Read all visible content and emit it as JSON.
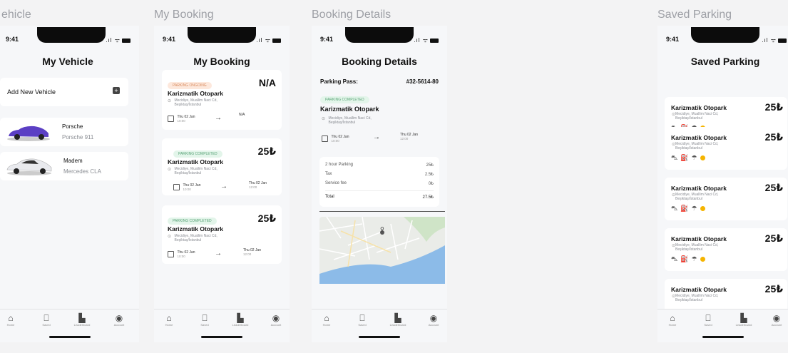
{
  "frames": [
    {
      "title": "ehicle"
    },
    {
      "title": "My Booking"
    },
    {
      "title": "Booking Details"
    },
    {
      "title": "Saved Parking"
    }
  ],
  "status_time": "9:41",
  "vehicle": {
    "title": "My Vehicle",
    "add_label": "Add New Vehicle",
    "cars": [
      {
        "name": "Porsche",
        "model": "Porsche 911",
        "color": "#5b3fc4"
      },
      {
        "name": "Madem",
        "model": "Mercedes CLA",
        "color": "#e9eaee"
      }
    ]
  },
  "booking": {
    "title": "My Booking",
    "cards": [
      {
        "status": "PARKING ONGOING",
        "state": "on",
        "price": "N/A",
        "name": "Karizmatik Otopark",
        "addr1": "Mecidiye, Muallim Naci Cd,",
        "addr2": "Beşiktaş/İstanbul",
        "from_date": "Thu 02 Jan",
        "from_time": "10:00",
        "to_date": "N/A",
        "to_time": ""
      },
      {
        "status": "PARKING COMPLETED",
        "state": "done",
        "price": "25₺",
        "name": "Karizmatik Otopark",
        "addr1": "Mecidiye, Muallim Naci Cd,",
        "addr2": "Beşiktaş/İstanbul",
        "from_date": "Thu 02 Jan",
        "from_time": "10:00",
        "to_date": "Thu 02 Jan",
        "to_time": "12:00"
      },
      {
        "status": "PARKING COMPLETED",
        "state": "done",
        "price": "25₺",
        "name": "Karizmatik Otopark",
        "addr1": "Mecidiye, Muallim Naci Cd,",
        "addr2": "Beşiktaş/İstanbul",
        "from_date": "Thu 02 Jan",
        "from_time": "10:00",
        "to_date": "Thu 02 Jan",
        "to_time": "12:00"
      }
    ]
  },
  "details": {
    "title": "Booking Details",
    "pass_label": "Parking Pass:",
    "pass_value": "#32-5614-80",
    "status": "PARKING COMPLETED",
    "name": "Karizmatik Otopark",
    "addr1": "Mecidiye, Muallim Naci Cd,",
    "addr2": "Beşiktaş/İstanbul",
    "from_date": "Thu 02 Jan",
    "from_time": "10:00",
    "to_date": "Thu 02 Jan",
    "to_time": "12:00",
    "lines": [
      {
        "label": "2 hour Parking",
        "value": "25₺"
      },
      {
        "label": "Tax",
        "value": "2.5₺"
      },
      {
        "label": "Service fee",
        "value": "0₺"
      }
    ],
    "total_label": "Total",
    "total_value": "27.5₺"
  },
  "saved": {
    "title": "Saved Parking",
    "cards": [
      {
        "name": "Karizmatik Otopark",
        "addr1": "Mecidiye, Muallim Naci Cd,",
        "addr2": "Beşiktaş/İstanbul",
        "price": "25₺"
      },
      {
        "name": "Karizmatik Otopark",
        "addr1": "Mecidiye, Muallim Naci Cd,",
        "addr2": "Beşiktaş/İstanbul",
        "price": "25₺"
      },
      {
        "name": "Karizmatik Otopark",
        "addr1": "Mecidiye, Muallim Naci Cd,",
        "addr2": "Beşiktaş/İstanbul",
        "price": "25₺"
      },
      {
        "name": "Karizmatik Otopark",
        "addr1": "Mecidiye, Muallim Naci Cd,",
        "addr2": "Beşiktaş/İstanbul",
        "price": "25₺"
      },
      {
        "name": "Karizmatik Otopark",
        "addr1": "Mecidiye, Muallim Naci Cd,",
        "addr2": "Beşiktaş/İstanbul",
        "price": "25₺"
      }
    ]
  },
  "tabs": [
    {
      "label": "Home",
      "icon": "home-icon"
    },
    {
      "label": "Saved",
      "icon": "bookmark-icon"
    },
    {
      "label": "Leaderboard",
      "icon": "leaderboard-icon"
    },
    {
      "label": "Account",
      "icon": "account-icon"
    }
  ],
  "colors": {
    "accent_ongoing": "#d88b5f",
    "accent_done": "#5aa478",
    "amenity_dot": "#f5b400"
  }
}
